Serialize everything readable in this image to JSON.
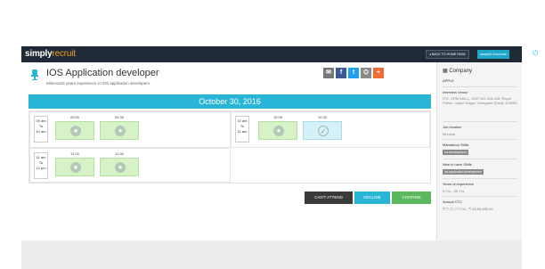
{
  "header": {
    "logo_prefix": "simply",
    "logo_suffix": "recruit",
    "back_button": "BACK TO HOME PAGE",
    "user": "swapnil chinchole",
    "power_icon": "power-icon"
  },
  "job": {
    "title": "IOS Application developer",
    "subtitle": "Minimum5 years experience in IOS application developers."
  },
  "share": {
    "email": "✉",
    "facebook": "f",
    "twitter": "t",
    "other": "⛭",
    "plus": "+"
  },
  "schedule": {
    "date": "October 30, 2016",
    "blocks": [
      {
        "from": "09 am",
        "to_word": "To",
        "until": "10 am",
        "slots": [
          {
            "time": "09.00"
          },
          {
            "time": "09.30"
          }
        ]
      },
      {
        "from": "10 am",
        "to_word": "To",
        "until": "11 am",
        "slots": [
          {
            "time": "10.00"
          },
          {
            "time": "10.30"
          }
        ]
      },
      {
        "from": "11 am",
        "to_word": "To",
        "until": "12 pm",
        "slots": [
          {
            "time": "11.00"
          },
          {
            "time": "11.30"
          }
        ]
      }
    ]
  },
  "actions": {
    "cant_attend": "CAN'T ATTEND",
    "decline": "DECLINE",
    "confirm": "CONFIRM"
  },
  "sidebar": {
    "company_heading": "Company",
    "company_name": "APPLE",
    "venue_label": "Interview Venue",
    "venue_value": "ITG, ORM MALL, UNIT NO 424-428, Royal Palms, mayur Nagar, Goregaon (East), 400065",
    "location_label": "Job location",
    "location_value": "Mumbai",
    "mandatory_label": "Mandatory Skills",
    "mandatory_tag": "ios development",
    "nice_label": "Nice to have Skills",
    "nice_tag": "ios application development",
    "experience_label": "Years of experience",
    "experience_value": "5 Yrs - 99 Yrs",
    "ctc_label": "Annual CTC",
    "ctc_value": "₹77,77,777.00 - ₹ 88,88,888.00"
  },
  "colors": {
    "topbar": "#1f2a36",
    "accent": "#29b6d6",
    "cant_attend": "#3a3a3a",
    "decline": "#29b6d6",
    "confirm": "#5cb85c"
  }
}
